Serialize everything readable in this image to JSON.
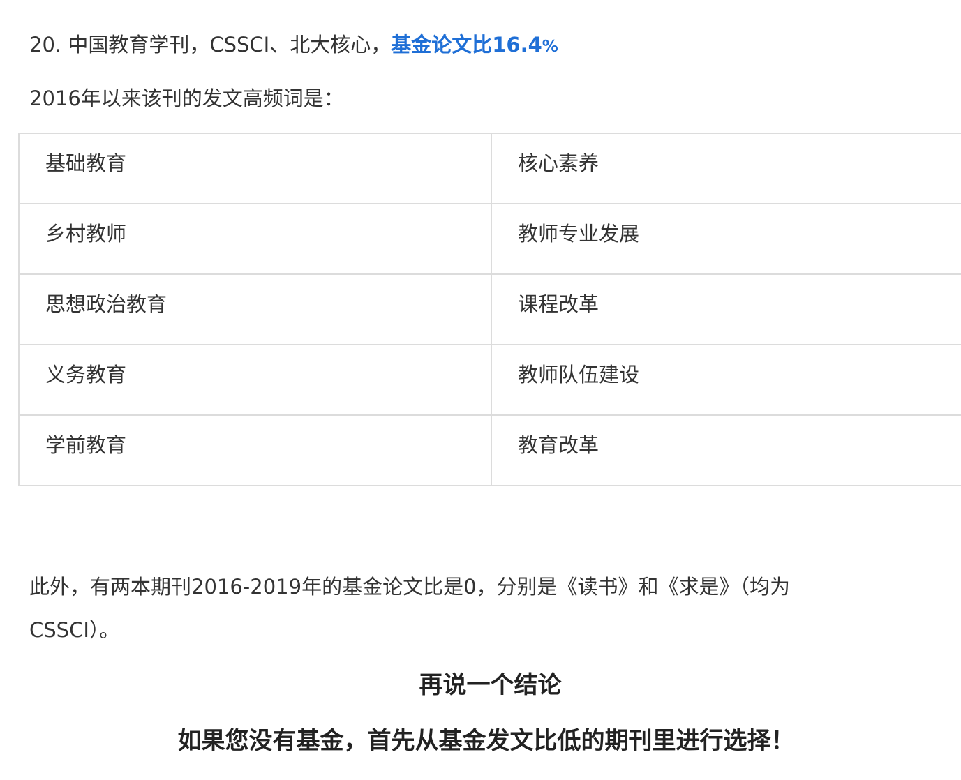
{
  "journal_line": {
    "prefix": "20. 中国教育学刊，CSSCI、北大核心，",
    "fund_label": "基金论文比16.4",
    "fund_pct_sign": "%"
  },
  "hf_intro": "2016年以来该刊的发文高频词是：",
  "keywords": {
    "rows": [
      [
        "基础教育",
        "核心素养"
      ],
      [
        "乡村教师",
        "教师专业发展"
      ],
      [
        "思想政治教育",
        "课程改革"
      ],
      [
        "义务教育",
        "教师队伍建设"
      ],
      [
        "学前教育",
        "教育改革"
      ]
    ]
  },
  "note": {
    "line1": "此外，有两本期刊2016-2019年的基金论文比是0，分别是《读书》和《求是》（均为",
    "line2": "CSSCI）。"
  },
  "conclusion_heading": "再说一个结论",
  "advice": "如果您没有基金，首先从基金发文比低的期刊里进行选择！",
  "colors": {
    "accent": "#1f6fd6",
    "text": "#333333",
    "border": "#dcdcdc"
  }
}
